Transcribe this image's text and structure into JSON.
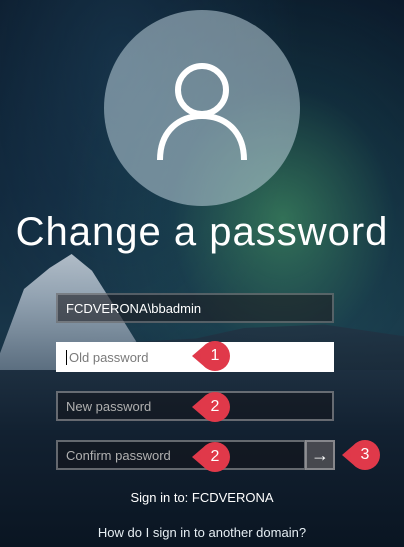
{
  "title": "Change a password",
  "account": "FCDVERONA\\bbadmin",
  "fields": {
    "old_password_placeholder": "Old password",
    "new_password_placeholder": "New password",
    "confirm_password_placeholder": "Confirm password"
  },
  "submit_icon": "arrow-right-icon",
  "annotations": [
    "1",
    "2",
    "2",
    "3"
  ],
  "annotation_color": "#e0394a",
  "sign_in_to": "Sign in to: FCDVERONA",
  "domain_help_link": "How do I sign in to another domain?"
}
